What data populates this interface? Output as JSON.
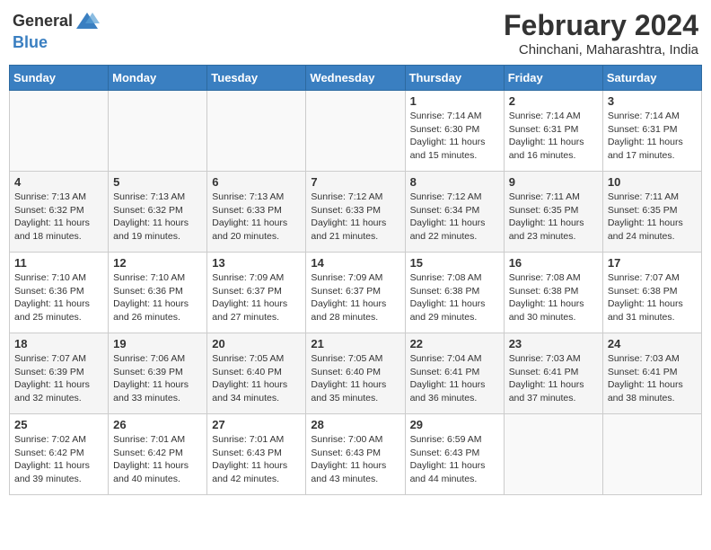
{
  "header": {
    "logo_general": "General",
    "logo_blue": "Blue",
    "month_title": "February 2024",
    "subtitle": "Chinchani, Maharashtra, India"
  },
  "days_of_week": [
    "Sunday",
    "Monday",
    "Tuesday",
    "Wednesday",
    "Thursday",
    "Friday",
    "Saturday"
  ],
  "weeks": [
    [
      {
        "day": "",
        "info": ""
      },
      {
        "day": "",
        "info": ""
      },
      {
        "day": "",
        "info": ""
      },
      {
        "day": "",
        "info": ""
      },
      {
        "day": "1",
        "info": "Sunrise: 7:14 AM\nSunset: 6:30 PM\nDaylight: 11 hours and 15 minutes."
      },
      {
        "day": "2",
        "info": "Sunrise: 7:14 AM\nSunset: 6:31 PM\nDaylight: 11 hours and 16 minutes."
      },
      {
        "day": "3",
        "info": "Sunrise: 7:14 AM\nSunset: 6:31 PM\nDaylight: 11 hours and 17 minutes."
      }
    ],
    [
      {
        "day": "4",
        "info": "Sunrise: 7:13 AM\nSunset: 6:32 PM\nDaylight: 11 hours and 18 minutes."
      },
      {
        "day": "5",
        "info": "Sunrise: 7:13 AM\nSunset: 6:32 PM\nDaylight: 11 hours and 19 minutes."
      },
      {
        "day": "6",
        "info": "Sunrise: 7:13 AM\nSunset: 6:33 PM\nDaylight: 11 hours and 20 minutes."
      },
      {
        "day": "7",
        "info": "Sunrise: 7:12 AM\nSunset: 6:33 PM\nDaylight: 11 hours and 21 minutes."
      },
      {
        "day": "8",
        "info": "Sunrise: 7:12 AM\nSunset: 6:34 PM\nDaylight: 11 hours and 22 minutes."
      },
      {
        "day": "9",
        "info": "Sunrise: 7:11 AM\nSunset: 6:35 PM\nDaylight: 11 hours and 23 minutes."
      },
      {
        "day": "10",
        "info": "Sunrise: 7:11 AM\nSunset: 6:35 PM\nDaylight: 11 hours and 24 minutes."
      }
    ],
    [
      {
        "day": "11",
        "info": "Sunrise: 7:10 AM\nSunset: 6:36 PM\nDaylight: 11 hours and 25 minutes."
      },
      {
        "day": "12",
        "info": "Sunrise: 7:10 AM\nSunset: 6:36 PM\nDaylight: 11 hours and 26 minutes."
      },
      {
        "day": "13",
        "info": "Sunrise: 7:09 AM\nSunset: 6:37 PM\nDaylight: 11 hours and 27 minutes."
      },
      {
        "day": "14",
        "info": "Sunrise: 7:09 AM\nSunset: 6:37 PM\nDaylight: 11 hours and 28 minutes."
      },
      {
        "day": "15",
        "info": "Sunrise: 7:08 AM\nSunset: 6:38 PM\nDaylight: 11 hours and 29 minutes."
      },
      {
        "day": "16",
        "info": "Sunrise: 7:08 AM\nSunset: 6:38 PM\nDaylight: 11 hours and 30 minutes."
      },
      {
        "day": "17",
        "info": "Sunrise: 7:07 AM\nSunset: 6:38 PM\nDaylight: 11 hours and 31 minutes."
      }
    ],
    [
      {
        "day": "18",
        "info": "Sunrise: 7:07 AM\nSunset: 6:39 PM\nDaylight: 11 hours and 32 minutes."
      },
      {
        "day": "19",
        "info": "Sunrise: 7:06 AM\nSunset: 6:39 PM\nDaylight: 11 hours and 33 minutes."
      },
      {
        "day": "20",
        "info": "Sunrise: 7:05 AM\nSunset: 6:40 PM\nDaylight: 11 hours and 34 minutes."
      },
      {
        "day": "21",
        "info": "Sunrise: 7:05 AM\nSunset: 6:40 PM\nDaylight: 11 hours and 35 minutes."
      },
      {
        "day": "22",
        "info": "Sunrise: 7:04 AM\nSunset: 6:41 PM\nDaylight: 11 hours and 36 minutes."
      },
      {
        "day": "23",
        "info": "Sunrise: 7:03 AM\nSunset: 6:41 PM\nDaylight: 11 hours and 37 minutes."
      },
      {
        "day": "24",
        "info": "Sunrise: 7:03 AM\nSunset: 6:41 PM\nDaylight: 11 hours and 38 minutes."
      }
    ],
    [
      {
        "day": "25",
        "info": "Sunrise: 7:02 AM\nSunset: 6:42 PM\nDaylight: 11 hours and 39 minutes."
      },
      {
        "day": "26",
        "info": "Sunrise: 7:01 AM\nSunset: 6:42 PM\nDaylight: 11 hours and 40 minutes."
      },
      {
        "day": "27",
        "info": "Sunrise: 7:01 AM\nSunset: 6:43 PM\nDaylight: 11 hours and 42 minutes."
      },
      {
        "day": "28",
        "info": "Sunrise: 7:00 AM\nSunset: 6:43 PM\nDaylight: 11 hours and 43 minutes."
      },
      {
        "day": "29",
        "info": "Sunrise: 6:59 AM\nSunset: 6:43 PM\nDaylight: 11 hours and 44 minutes."
      },
      {
        "day": "",
        "info": ""
      },
      {
        "day": "",
        "info": ""
      }
    ]
  ]
}
